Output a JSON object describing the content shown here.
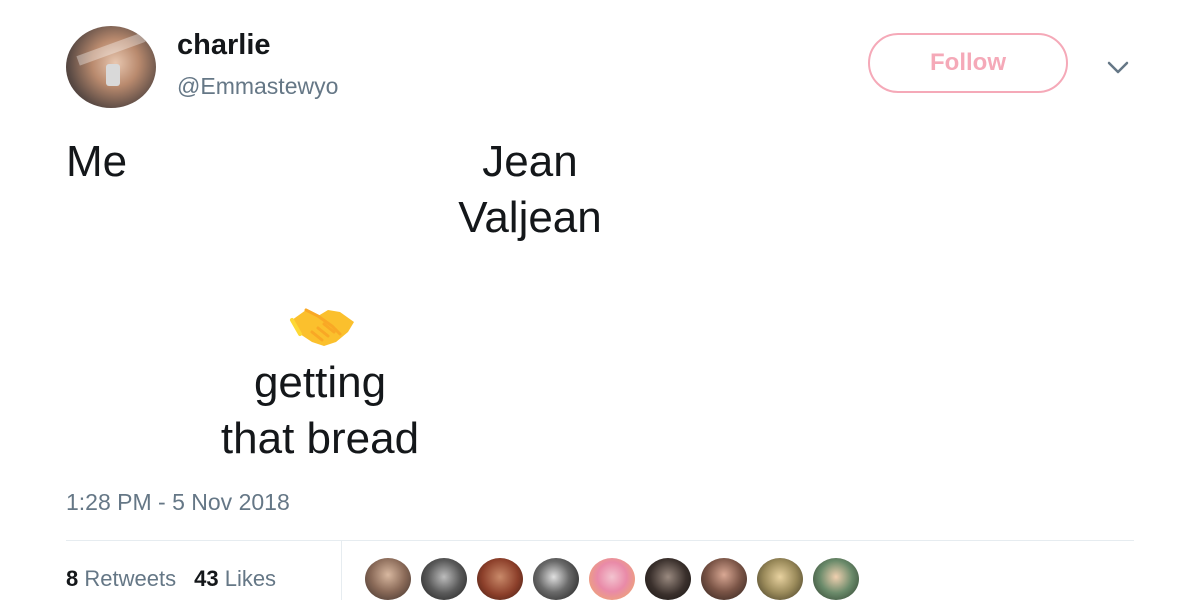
{
  "tweet": {
    "author": {
      "display_name": "charlie",
      "handle": "@Emmastewyo",
      "avatar_icon": "profile-photo"
    },
    "follow_label": "Follow",
    "menu_icon": "chevron-down-icon",
    "body": {
      "left_label": "Me",
      "right_label_line1": "Jean",
      "right_label_line2": "Valjean",
      "emoji": "handshake-emoji",
      "bottom_label_line1": "getting",
      "bottom_label_line2": "that bread"
    },
    "timestamp": "1:28 PM - 5 Nov 2018",
    "stats": {
      "retweets_count": "8",
      "retweets_label": "Retweets",
      "likes_count": "43",
      "likes_label": "Likes"
    },
    "colors": {
      "follow_accent": "#f5a9b8",
      "secondary_text": "#657786",
      "primary_text": "#14171a",
      "divider": "#e6ecf0"
    }
  }
}
